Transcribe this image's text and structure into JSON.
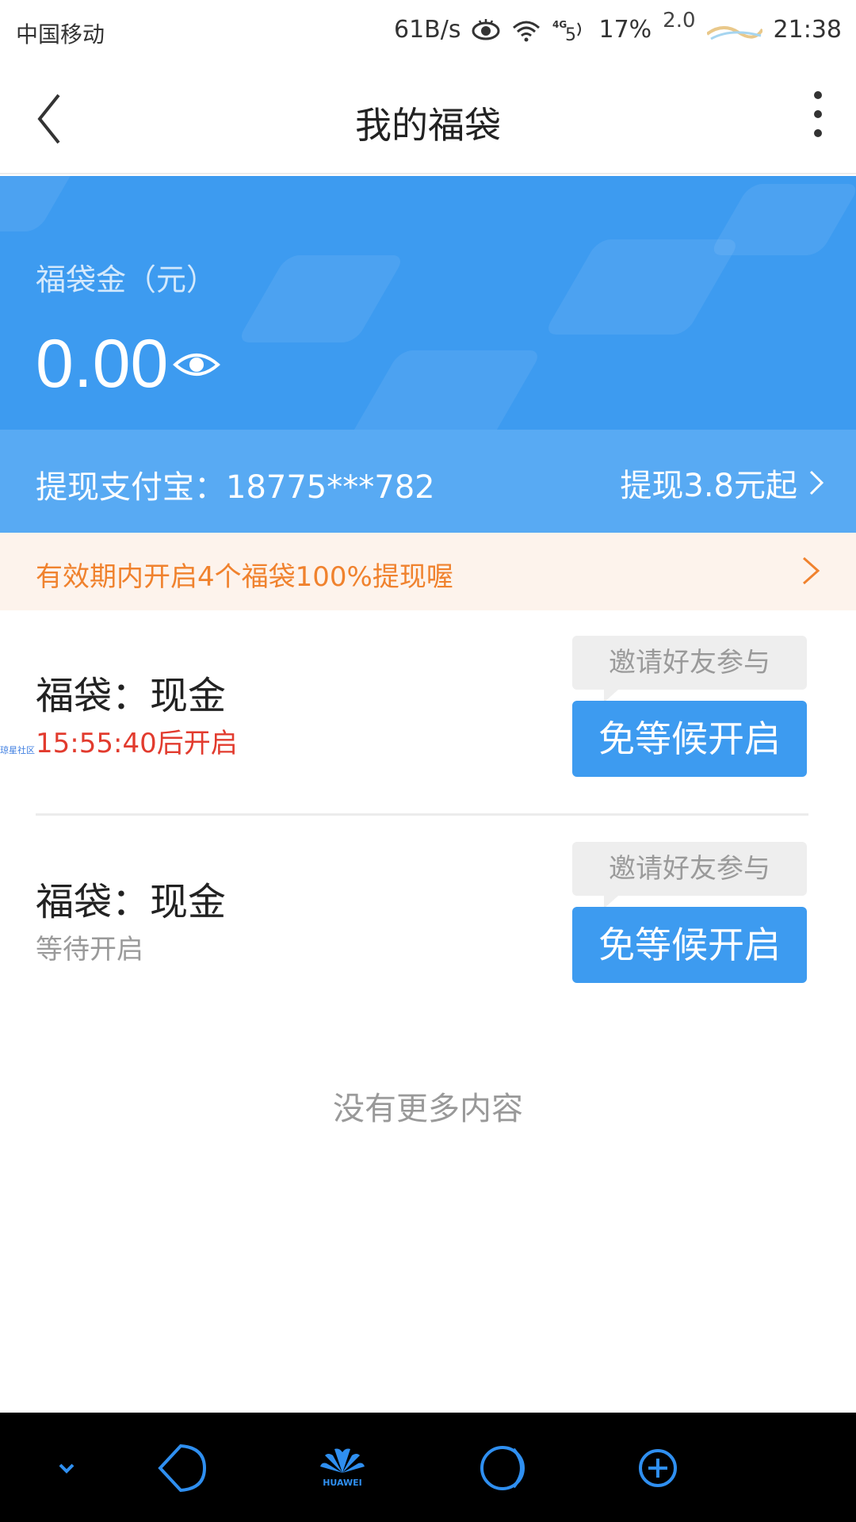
{
  "status_bar": {
    "carrier": "中国移动",
    "net_speed": "61B/s",
    "network_type": "4G",
    "battery": "17%",
    "badge": "2.0",
    "time": "21:38"
  },
  "nav": {
    "title": "我的福袋",
    "back_icon": "chevron-left-icon",
    "more_icon": "more-vertical-icon"
  },
  "balance": {
    "label": "福袋金（元）",
    "amount": "0.00",
    "eye_icon": "eye-icon"
  },
  "withdraw": {
    "account": "提现支付宝：18775***782",
    "link_label": "提现3.8元起"
  },
  "notice": {
    "text": "有效期内开启4个福袋100%提现喔"
  },
  "items": [
    {
      "title": "福袋：现金",
      "status": "15:55:40后开启",
      "status_color": "#e23b2e",
      "invite_label": "邀请好友参与",
      "open_label": "免等候开启"
    },
    {
      "title": "福袋：现金",
      "status": "等待开启",
      "status_color": "#9a9a9a",
      "invite_label": "邀请好友参与",
      "open_label": "免等候开启"
    }
  ],
  "footer": {
    "no_more": "没有更多内容"
  },
  "watermark": "琼星社区",
  "system_nav": {
    "brand": "HUAWEI",
    "buttons": [
      "chevron-down-icon",
      "back-icon",
      "huawei-logo-icon",
      "home-icon",
      "plus-circle-icon"
    ]
  },
  "colors": {
    "primary": "#3d9bf0",
    "notice_bg": "#fdf3ec",
    "notice_text": "#f0822e",
    "countdown": "#e23b2e"
  }
}
